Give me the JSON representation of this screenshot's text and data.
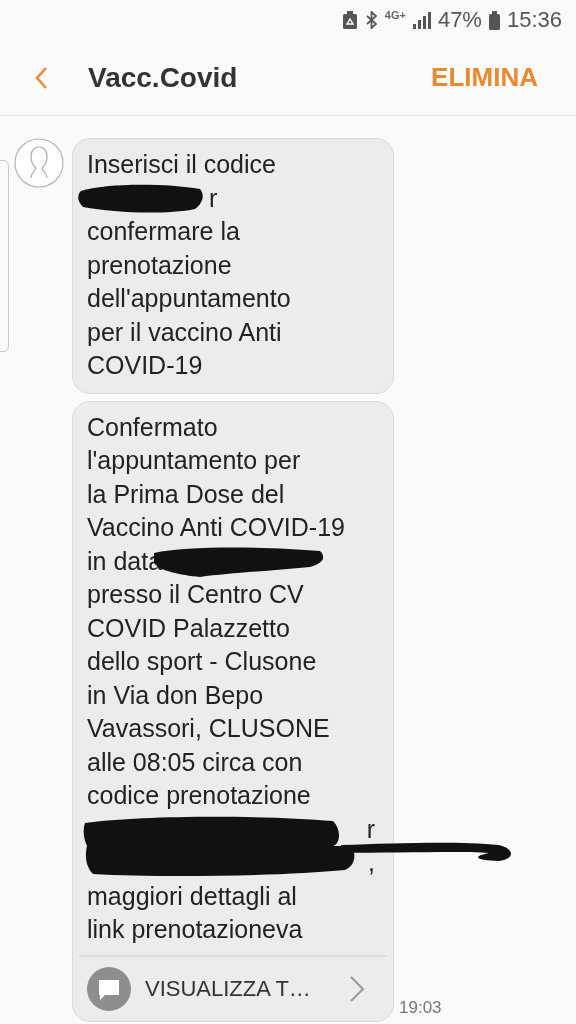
{
  "status_bar": {
    "network": "4G+",
    "battery": "47%",
    "time": "15:36"
  },
  "header": {
    "title": "Vacc.Covid",
    "action": "ELIMINA"
  },
  "messages": [
    {
      "show_avatar": true,
      "lines": [
        {
          "kind": "plain",
          "text": "Inserisci il codice"
        },
        {
          "kind": "lead",
          "text": "r"
        },
        {
          "kind": "plain",
          "text": "confermare la"
        },
        {
          "kind": "plain",
          "text": "prenotazione"
        },
        {
          "kind": "plain",
          "text": "dell'appuntamento"
        },
        {
          "kind": "plain",
          "text": "per il vaccino Anti"
        },
        {
          "kind": "plain",
          "text": "COVID-19"
        }
      ]
    },
    {
      "show_avatar": false,
      "lines": [
        {
          "kind": "plain",
          "text": "Confermato"
        },
        {
          "kind": "plain",
          "text": "l'appuntamento per"
        },
        {
          "kind": "plain",
          "text": "la Prima Dose del"
        },
        {
          "kind": "plain",
          "text": "Vaccino Anti COVID-19"
        },
        {
          "kind": "trail",
          "text": "in data"
        },
        {
          "kind": "plain",
          "text": "presso il Centro CV"
        },
        {
          "kind": "plain",
          "text": "COVID Palazzetto"
        },
        {
          "kind": "plain",
          "text": "dello sport - Clusone"
        },
        {
          "kind": "plain",
          "text": "in Via don Bepo"
        },
        {
          "kind": "plain",
          "text": "Vavassori, CLUSONE"
        },
        {
          "kind": "plain",
          "text": "alle 08:05 circa con"
        },
        {
          "kind": "plain",
          "text": "codice prenotazione"
        },
        {
          "kind": "tail",
          "text": "r"
        },
        {
          "kind": "wide",
          "text": ","
        },
        {
          "kind": "plain",
          "text": "maggiori dettagli al"
        },
        {
          "kind": "plain",
          "text": "link prenotazioneva"
        }
      ],
      "link_preview": {
        "label": "VISUALIZZA T…"
      },
      "time": "19:03"
    }
  ]
}
